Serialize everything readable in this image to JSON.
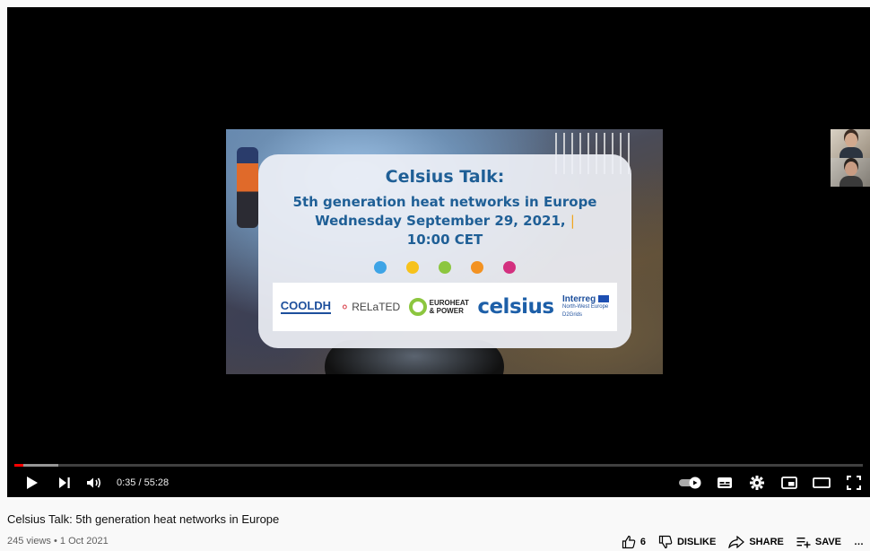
{
  "video": {
    "slide": {
      "title": "Celsius Talk:",
      "subtitle": "5th generation heat networks in Europe",
      "date": "Wednesday September 29, 2021,",
      "date_caret": "|",
      "time": "10:00 CET",
      "dot_colors": [
        "#3ea4e6",
        "#f7c21b",
        "#8cc63f",
        "#f39222",
        "#d3307f"
      ],
      "logos": {
        "cooldh": "COOLDH",
        "related": "RELaTED",
        "euroheat_line1": "EUROHEAT",
        "euroheat_line2": "& POWER",
        "celsius": "celsius",
        "interreg": "Interreg",
        "interreg_region": "North-West Europe",
        "interreg_project": "D2Grids"
      }
    },
    "progress": {
      "played_fraction": 0.011,
      "loaded_fraction": 0.052
    }
  },
  "controls": {
    "current_time": "0:35",
    "duration": "55:28",
    "time_separator": " / "
  },
  "info": {
    "title": "Celsius Talk: 5th generation heat networks in Europe",
    "views": "245 views",
    "separator": " • ",
    "date": "1 Oct 2021"
  },
  "actions": {
    "likes": "6",
    "dislike": "DISLIKE",
    "share": "SHARE",
    "save": "SAVE",
    "more": "…"
  },
  "colors": {
    "accent": "#ff0000",
    "slide_text": "#1f5f96"
  }
}
